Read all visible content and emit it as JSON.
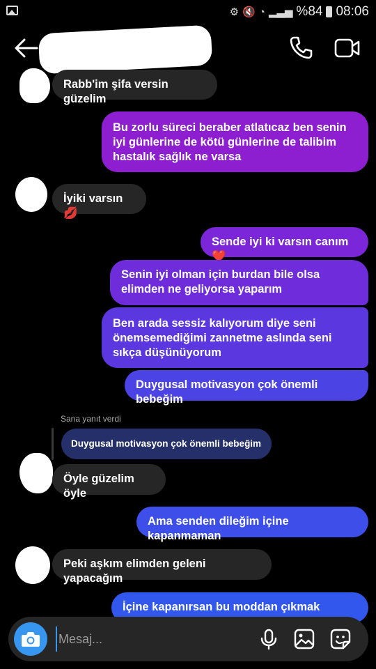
{
  "status_bar": {
    "battery": "%84",
    "time": "08:06"
  },
  "messages": [
    {
      "text": "Rabb'im şifa versin güzelim",
      "direction": "in"
    },
    {
      "text": "Bu zorlu süreci beraber atlatıcaz ben senin iyi günlerine de kötü günlerine de talibim hastalık sağlık ne varsa",
      "direction": "out"
    },
    {
      "text": "İyiki varsın 💋",
      "direction": "in"
    },
    {
      "text": "Sende iyi ki varsın canım ❤️",
      "direction": "out"
    },
    {
      "text": "Senin iyi olman için burdan bile olsa elimden ne geliyorsa yaparım",
      "direction": "out"
    },
    {
      "text": "Ben arada sessiz kalıyorum diye seni önemsemediğimi zannetme aslında seni sıkça düşünüyorum",
      "direction": "out"
    },
    {
      "text": "Duygusal motivasyon çok önemli bebeğim",
      "direction": "out"
    },
    {
      "text": "Öyle güzelim öyle",
      "direction": "in"
    },
    {
      "text": "Ama senden dileğim içine kapanmaman",
      "direction": "out"
    },
    {
      "text": "Peki aşkım elimden geleni yapacağım",
      "direction": "in"
    },
    {
      "text": "İçine kapanırsan bu moddan çıkmak zorlaşır",
      "direction": "out"
    }
  ],
  "reply": {
    "label": "Sana yanıt verdi",
    "quoted_text": "Duygusal motivasyon çok önemli bebeğim"
  },
  "composer": {
    "placeholder": "Mesaj..."
  },
  "colors": {
    "accent": "#3797f0",
    "incoming_bubble": "#262626",
    "outgoing_top": "#8d1fd0",
    "outgoing_bottom": "#3257ec"
  },
  "icons": [
    "back-arrow-icon",
    "phone-icon",
    "video-call-icon",
    "camera-icon",
    "microphone-icon",
    "gallery-icon",
    "sticker-icon"
  ]
}
